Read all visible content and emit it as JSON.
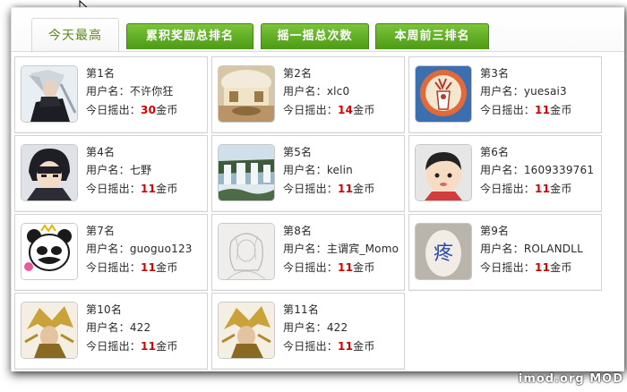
{
  "tabs": [
    {
      "label": "今天最高",
      "active": true
    },
    {
      "label": "累积奖励总排名",
      "active": false
    },
    {
      "label": "摇一摇总次数",
      "active": false
    },
    {
      "label": "本周前三排名",
      "active": false
    }
  ],
  "labels": {
    "user_prefix": "用户名：",
    "today_prefix": "今日摇出：",
    "currency": "金币"
  },
  "accent": {
    "tab_green": "#5aa821",
    "value_red": "#d40000"
  },
  "ranks": [
    {
      "rank": "第1名",
      "username": "不许你狂",
      "amount": "30",
      "avatar": "warrior-avatar-icon"
    },
    {
      "rank": "第2名",
      "username": "xlc0",
      "amount": "14",
      "avatar": "room-photo-avatar-icon"
    },
    {
      "rank": "第3名",
      "username": "yuesai3",
      "amount": "11",
      "avatar": "deer-art-avatar-icon"
    },
    {
      "rank": "第4名",
      "username": "七野",
      "amount": "11",
      "avatar": "anime-boy-avatar-icon"
    },
    {
      "rank": "第5名",
      "username": "kelin",
      "amount": "11",
      "avatar": "waterfall-avatar-icon"
    },
    {
      "rank": "第6名",
      "username": "1609339761",
      "amount": "11",
      "avatar": "cartoon-kid-avatar-icon"
    },
    {
      "rank": "第7名",
      "username": "guoguo123",
      "amount": "11",
      "avatar": "panda-avatar-icon"
    },
    {
      "rank": "第8名",
      "username": "主谓宾_Momo",
      "amount": "11",
      "avatar": "sketch-avatar-icon"
    },
    {
      "rank": "第9名",
      "username": "ROLANDLL",
      "amount": "11",
      "avatar": "egg-avatar-icon"
    },
    {
      "rank": "第10名",
      "username": "422",
      "amount": "11",
      "avatar": "golden-warrior-avatar-icon"
    },
    {
      "rank": "第11名",
      "username": "422",
      "amount": "11",
      "avatar": "golden-warrior-avatar-icon"
    }
  ],
  "egg_char": "疼",
  "watermark": "imod.org    MOD"
}
